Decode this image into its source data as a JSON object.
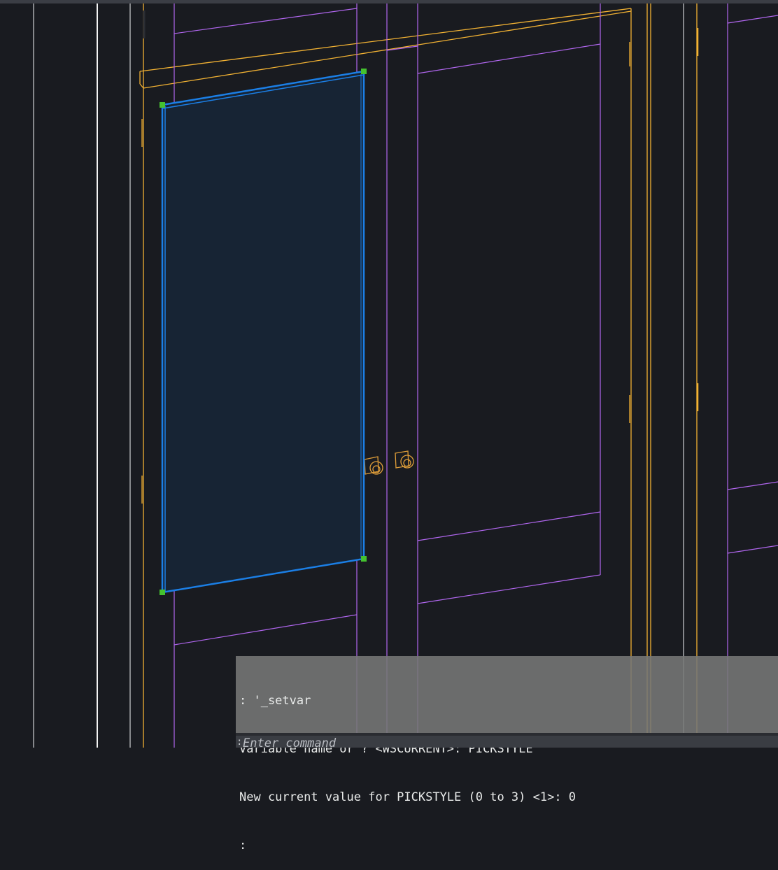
{
  "app": {
    "colors": {
      "background": "#191b20",
      "wall_line_white": "#e8e8e8",
      "frame_orange": "#f2b233",
      "door_purple": "#b066ee",
      "selection_blue": "#1b7fe6",
      "selection_fill": "#172434",
      "grip_green": "#45c22f",
      "knob_gold": "#e09e39"
    }
  },
  "command_line": {
    "history": [
      ": '_setvar",
      "Variable name or ? <WSCURRENT>: PICKSTYLE",
      "New current value for PICKSTYLE (0 to 3) <1>: 0",
      ":"
    ],
    "prompt_prefix": ":",
    "input_placeholder": "Enter command"
  }
}
